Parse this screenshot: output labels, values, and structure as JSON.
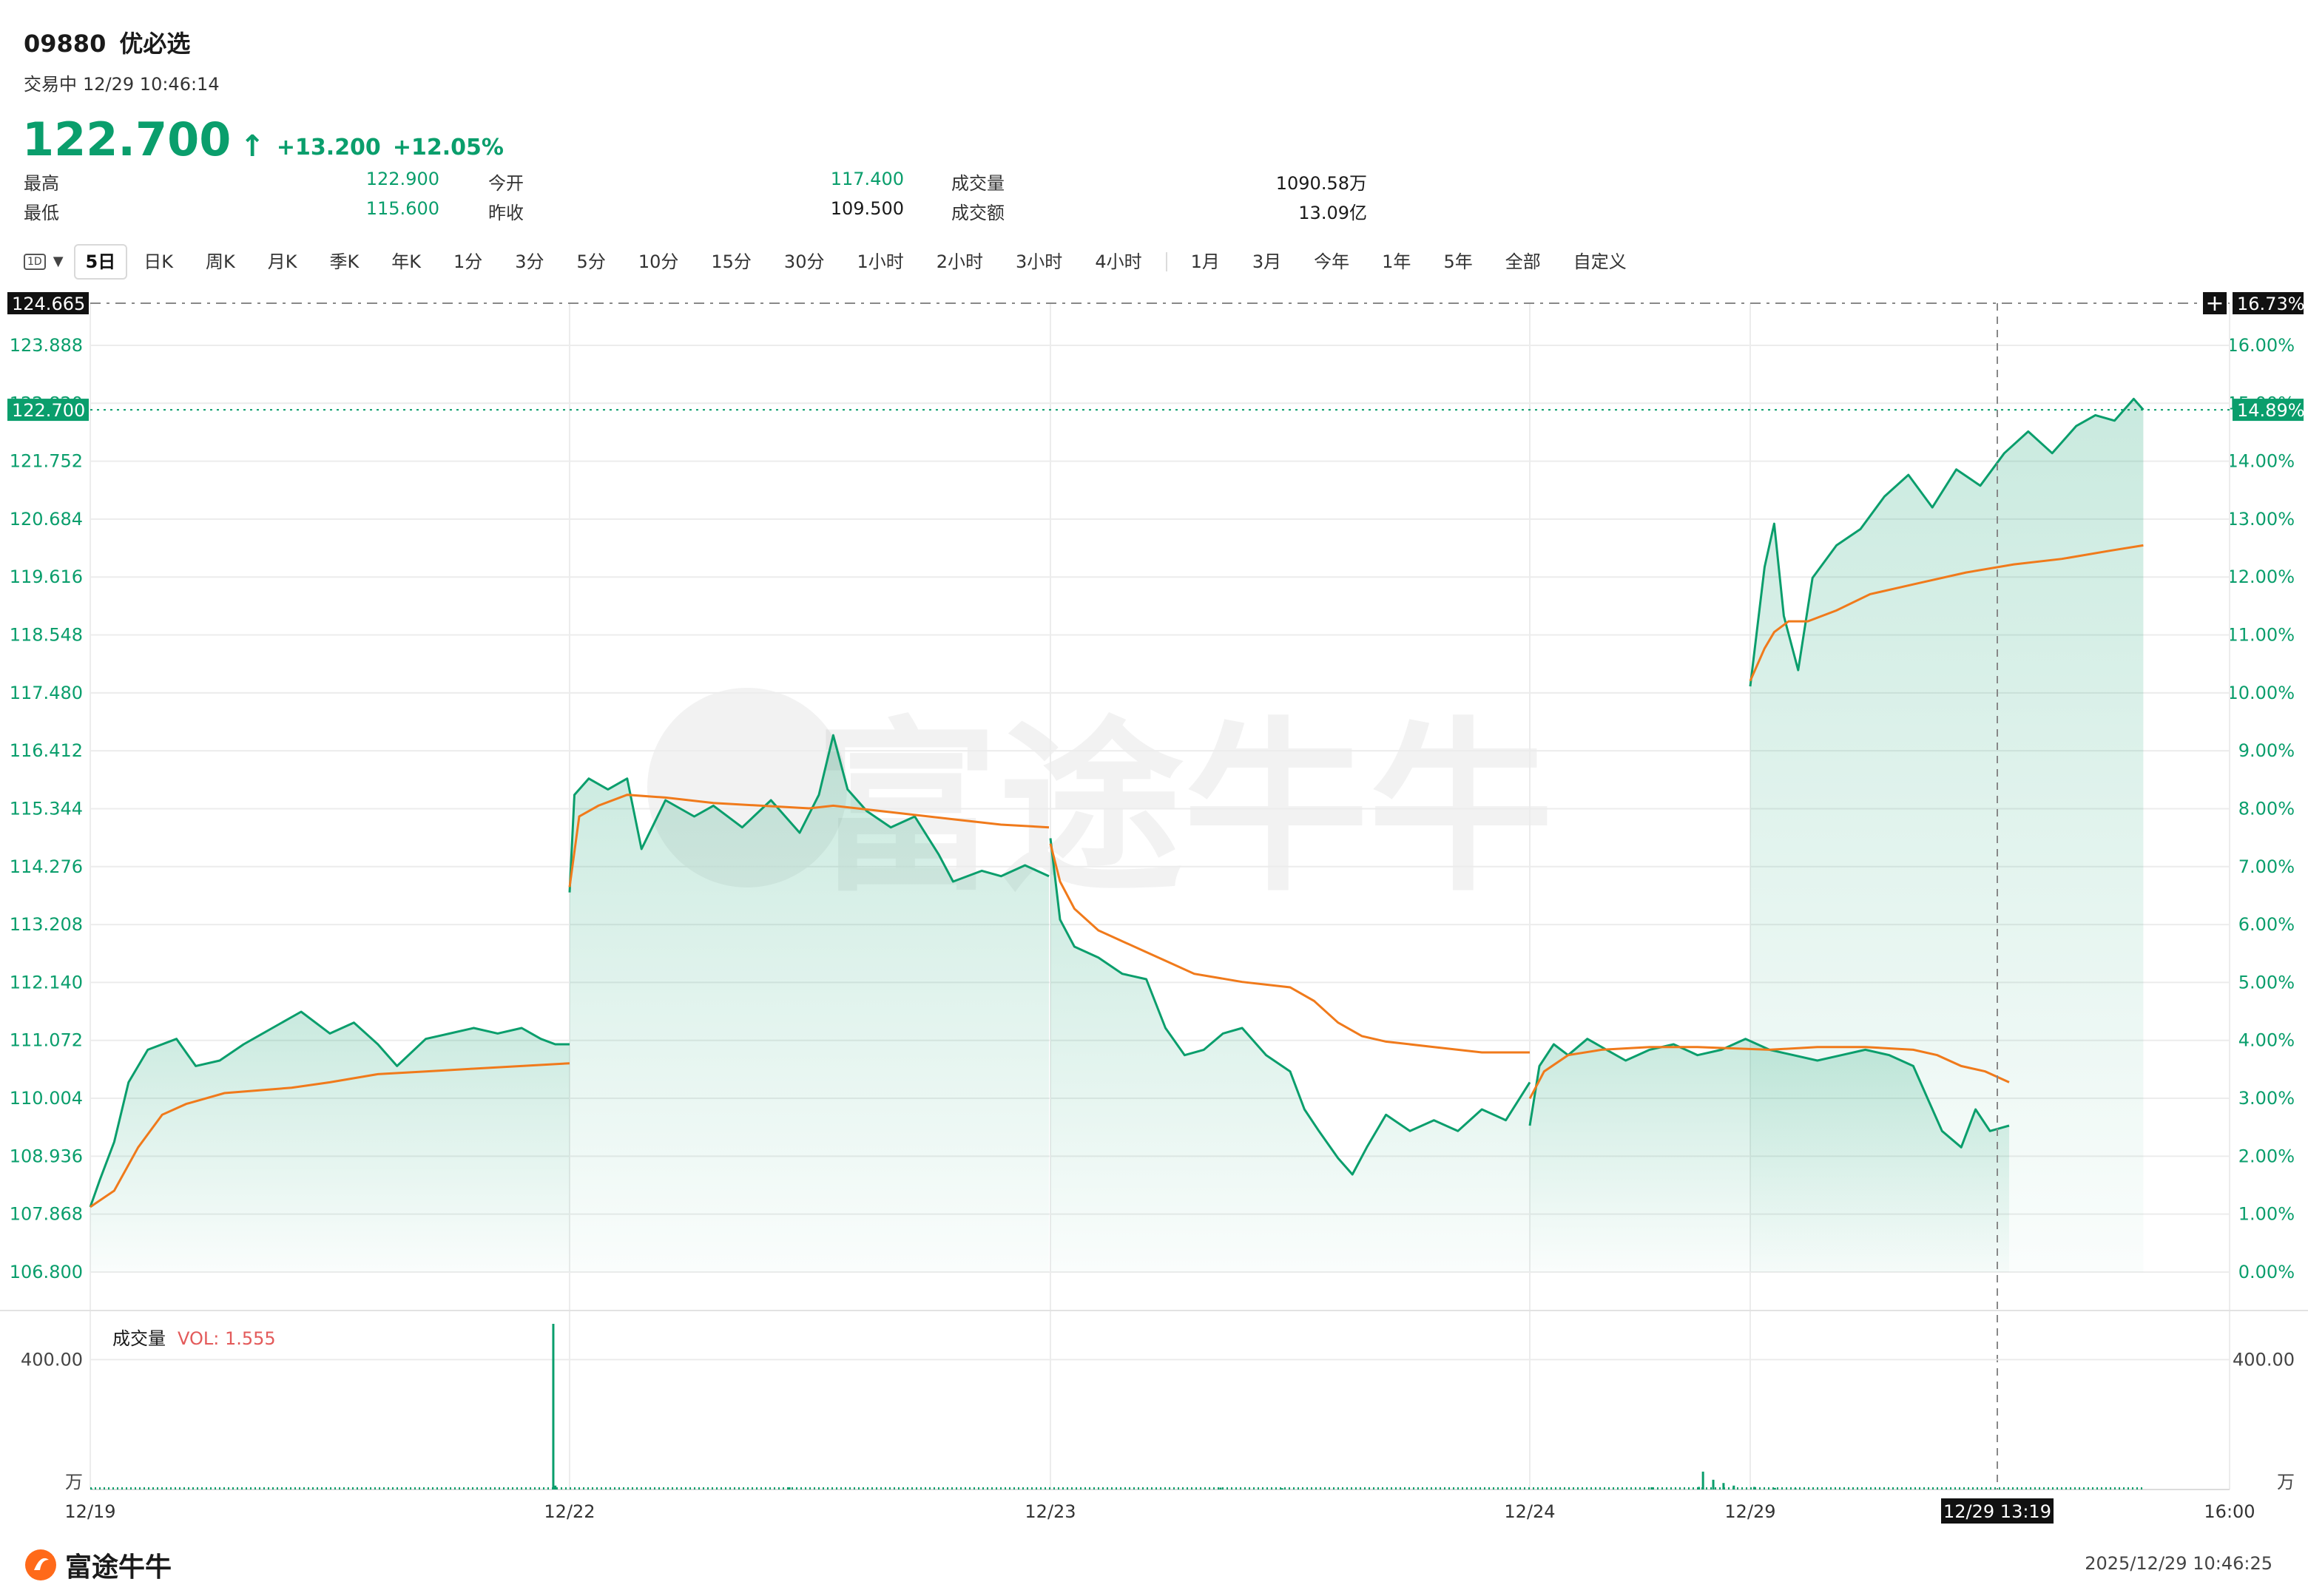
{
  "header": {
    "code": "09880",
    "name": "优必选",
    "status": "交易中",
    "time": "12/29 10:46:14",
    "price": "122.700",
    "arrow_icon": "arrow-up-icon",
    "change": "+13.200",
    "change_pct": "+12.05%"
  },
  "stats": [
    {
      "label": "最高",
      "value": "122.900",
      "color": "green"
    },
    {
      "label": "今开",
      "value": "117.400",
      "color": "green"
    },
    {
      "label": "成交量",
      "value": "1090.58万",
      "color": "dark"
    },
    {
      "label": "最低",
      "value": "115.600",
      "color": "green"
    },
    {
      "label": "昨收",
      "value": "109.500",
      "color": "dark"
    },
    {
      "label": "成交额",
      "value": "13.09亿",
      "color": "dark"
    }
  ],
  "tabs": {
    "first": "1D",
    "items": [
      "5日",
      "日K",
      "周K",
      "月K",
      "季K",
      "年K",
      "1分",
      "3分",
      "5分",
      "10分",
      "15分",
      "30分",
      "1小时",
      "2小时",
      "3小时",
      "4小时",
      "1月",
      "3月",
      "今年",
      "1年",
      "5年",
      "全部",
      "自定义"
    ],
    "active": "5日"
  },
  "chart_data": {
    "type": "line",
    "title": "",
    "x": [
      "12/19",
      "12/22",
      "12/23",
      "12/24",
      "12/29"
    ],
    "x_axis_end_label": "16:00",
    "crosshair": {
      "price": "124.665",
      "pct": "16.73%",
      "time": "12/29 13:19"
    },
    "current": {
      "price": "122.700",
      "pct": "14.89%"
    },
    "ylim": [
      106.8,
      124.665
    ],
    "y_ticks_left": [
      "123.888",
      "122.820",
      "121.752",
      "120.684",
      "119.616",
      "118.548",
      "117.480",
      "116.412",
      "115.344",
      "114.276",
      "113.208",
      "112.140",
      "111.072",
      "110.004",
      "108.936",
      "107.868",
      "106.800"
    ],
    "y_ticks_right": [
      "16.00%",
      "15.00%",
      "14.00%",
      "13.00%",
      "12.00%",
      "11.00%",
      "10.00%",
      "9.00%",
      "8.00%",
      "7.00%",
      "6.00%",
      "5.00%",
      "4.00%",
      "3.00%",
      "2.00%",
      "1.00%",
      "0.00%"
    ],
    "series": [
      {
        "values": [
          [
            [
              0,
              108.0
            ],
            [
              0.02,
              108.5
            ],
            [
              0.05,
              109.2
            ],
            [
              0.08,
              110.3
            ],
            [
              0.12,
              110.9
            ],
            [
              0.18,
              111.1
            ],
            [
              0.22,
              110.6
            ],
            [
              0.27,
              110.7
            ],
            [
              0.32,
              111.0
            ],
            [
              0.38,
              111.3
            ],
            [
              0.44,
              111.6
            ],
            [
              0.5,
              111.2
            ],
            [
              0.55,
              111.4
            ],
            [
              0.6,
              111.0
            ],
            [
              0.64,
              110.6
            ],
            [
              0.7,
              111.1
            ],
            [
              0.75,
              111.2
            ],
            [
              0.8,
              111.3
            ],
            [
              0.85,
              111.2
            ],
            [
              0.9,
              111.3
            ],
            [
              0.94,
              111.1
            ],
            [
              0.97,
              111.0
            ],
            [
              1.0,
              111.0
            ]
          ],
          [
            [
              0,
              113.8
            ],
            [
              0.01,
              115.6
            ],
            [
              0.04,
              115.9
            ],
            [
              0.08,
              115.7
            ],
            [
              0.12,
              115.9
            ],
            [
              0.15,
              114.6
            ],
            [
              0.2,
              115.5
            ],
            [
              0.26,
              115.2
            ],
            [
              0.3,
              115.4
            ],
            [
              0.36,
              115.0
            ],
            [
              0.42,
              115.5
            ],
            [
              0.48,
              114.9
            ],
            [
              0.52,
              115.6
            ],
            [
              0.55,
              116.7
            ],
            [
              0.58,
              115.7
            ],
            [
              0.62,
              115.3
            ],
            [
              0.67,
              115.0
            ],
            [
              0.72,
              115.2
            ],
            [
              0.77,
              114.5
            ],
            [
              0.8,
              114.0
            ],
            [
              0.86,
              114.2
            ],
            [
              0.9,
              114.1
            ],
            [
              0.95,
              114.3
            ],
            [
              1.0,
              114.1
            ]
          ],
          [
            [
              0,
              114.8
            ],
            [
              0.02,
              113.3
            ],
            [
              0.05,
              112.8
            ],
            [
              0.1,
              112.6
            ],
            [
              0.15,
              112.3
            ],
            [
              0.2,
              112.2
            ],
            [
              0.24,
              111.3
            ],
            [
              0.28,
              110.8
            ],
            [
              0.32,
              110.9
            ],
            [
              0.36,
              111.2
            ],
            [
              0.4,
              111.3
            ],
            [
              0.45,
              110.8
            ],
            [
              0.5,
              110.5
            ],
            [
              0.53,
              109.8
            ],
            [
              0.56,
              109.4
            ],
            [
              0.6,
              108.9
            ],
            [
              0.63,
              108.6
            ],
            [
              0.66,
              109.1
            ],
            [
              0.7,
              109.7
            ],
            [
              0.75,
              109.4
            ],
            [
              0.8,
              109.6
            ],
            [
              0.85,
              109.4
            ],
            [
              0.9,
              109.8
            ],
            [
              0.95,
              109.6
            ],
            [
              1.0,
              110.3
            ]
          ],
          [
            [
              0,
              109.5
            ],
            [
              0.02,
              110.6
            ],
            [
              0.05,
              111.0
            ],
            [
              0.08,
              110.8
            ],
            [
              0.12,
              111.1
            ],
            [
              0.16,
              110.9
            ],
            [
              0.2,
              110.7
            ],
            [
              0.25,
              110.9
            ],
            [
              0.3,
              111.0
            ],
            [
              0.35,
              110.8
            ],
            [
              0.4,
              110.9
            ],
            [
              0.45,
              111.1
            ],
            [
              0.5,
              110.9
            ],
            [
              0.55,
              110.8
            ],
            [
              0.6,
              110.7
            ],
            [
              0.65,
              110.8
            ],
            [
              0.7,
              110.9
            ],
            [
              0.75,
              110.8
            ],
            [
              0.8,
              110.6
            ],
            [
              0.83,
              110.0
            ],
            [
              0.86,
              109.4
            ],
            [
              0.9,
              109.1
            ],
            [
              0.93,
              109.8
            ],
            [
              0.96,
              109.4
            ],
            [
              1.0,
              109.5
            ]
          ],
          [
            [
              0,
              117.6
            ],
            [
              0.03,
              119.8
            ],
            [
              0.05,
              120.6
            ],
            [
              0.07,
              118.9
            ],
            [
              0.1,
              117.9
            ],
            [
              0.13,
              119.6
            ],
            [
              0.18,
              120.2
            ],
            [
              0.23,
              120.5
            ],
            [
              0.28,
              121.1
            ],
            [
              0.33,
              121.5
            ],
            [
              0.38,
              120.9
            ],
            [
              0.43,
              121.6
            ],
            [
              0.48,
              121.3
            ],
            [
              0.53,
              121.9
            ],
            [
              0.58,
              122.3
            ],
            [
              0.63,
              121.9
            ],
            [
              0.68,
              122.4
            ],
            [
              0.72,
              122.6
            ],
            [
              0.76,
              122.5
            ],
            [
              0.8,
              122.9
            ],
            [
              0.82,
              122.7
            ]
          ]
        ]
      },
      {
        "values": [
          [
            [
              0,
              108.0
            ],
            [
              0.05,
              108.3
            ],
            [
              0.1,
              109.1
            ],
            [
              0.15,
              109.7
            ],
            [
              0.2,
              109.9
            ],
            [
              0.28,
              110.1
            ],
            [
              0.35,
              110.15
            ],
            [
              0.42,
              110.2
            ],
            [
              0.5,
              110.3
            ],
            [
              0.6,
              110.45
            ],
            [
              0.7,
              110.5
            ],
            [
              0.8,
              110.55
            ],
            [
              0.9,
              110.6
            ],
            [
              1.0,
              110.65
            ]
          ],
          [
            [
              0,
              113.9
            ],
            [
              0.02,
              115.2
            ],
            [
              0.06,
              115.4
            ],
            [
              0.12,
              115.6
            ],
            [
              0.2,
              115.55
            ],
            [
              0.3,
              115.45
            ],
            [
              0.4,
              115.4
            ],
            [
              0.5,
              115.35
            ],
            [
              0.55,
              115.4
            ],
            [
              0.6,
              115.35
            ],
            [
              0.7,
              115.25
            ],
            [
              0.8,
              115.15
            ],
            [
              0.9,
              115.05
            ],
            [
              1.0,
              115.0
            ]
          ],
          [
            [
              0,
              114.7
            ],
            [
              0.02,
              114.0
            ],
            [
              0.05,
              113.5
            ],
            [
              0.1,
              113.1
            ],
            [
              0.15,
              112.9
            ],
            [
              0.2,
              112.7
            ],
            [
              0.25,
              112.5
            ],
            [
              0.3,
              112.3
            ],
            [
              0.4,
              112.15
            ],
            [
              0.5,
              112.05
            ],
            [
              0.55,
              111.8
            ],
            [
              0.6,
              111.4
            ],
            [
              0.65,
              111.15
            ],
            [
              0.7,
              111.05
            ],
            [
              0.8,
              110.95
            ],
            [
              0.9,
              110.85
            ],
            [
              1.0,
              110.85
            ]
          ],
          [
            [
              0,
              110.0
            ],
            [
              0.03,
              110.5
            ],
            [
              0.08,
              110.8
            ],
            [
              0.15,
              110.9
            ],
            [
              0.25,
              110.95
            ],
            [
              0.35,
              110.95
            ],
            [
              0.5,
              110.9
            ],
            [
              0.6,
              110.95
            ],
            [
              0.7,
              110.95
            ],
            [
              0.8,
              110.9
            ],
            [
              0.85,
              110.8
            ],
            [
              0.9,
              110.6
            ],
            [
              0.95,
              110.5
            ],
            [
              1.0,
              110.3
            ]
          ],
          [
            [
              0,
              117.7
            ],
            [
              0.03,
              118.3
            ],
            [
              0.05,
              118.6
            ],
            [
              0.08,
              118.8
            ],
            [
              0.12,
              118.8
            ],
            [
              0.18,
              119.0
            ],
            [
              0.25,
              119.3
            ],
            [
              0.35,
              119.5
            ],
            [
              0.45,
              119.7
            ],
            [
              0.55,
              119.85
            ],
            [
              0.65,
              119.95
            ],
            [
              0.75,
              120.1
            ],
            [
              0.82,
              120.2
            ]
          ]
        ]
      }
    ],
    "volume": {
      "label": "成交量",
      "vol_text": "VOL: 1.555",
      "y_tick": "400.00",
      "y_unit": "万",
      "ylim": [
        0,
        510
      ],
      "spikes": [
        [
          0.0,
          3
        ],
        [
          0.225,
          510
        ],
        [
          0.226,
          12
        ],
        [
          0.34,
          7
        ],
        [
          0.55,
          6
        ],
        [
          0.58,
          4
        ],
        [
          0.76,
          7
        ],
        [
          0.783,
          8
        ],
        [
          0.785,
          55
        ],
        [
          0.79,
          30
        ],
        [
          0.795,
          20
        ],
        [
          0.8,
          12
        ],
        [
          0.81,
          8
        ],
        [
          0.82,
          5
        ],
        [
          0.83,
          4
        ]
      ]
    },
    "colors": {
      "price": "#0a9e6c",
      "avg": "#f07a1b",
      "grid": "#ececec",
      "current_tag": "#0a9e6c",
      "crosshair_tag": "#111111",
      "vol": "#0a9e6c",
      "vol_label": "#e35a5a"
    }
  },
  "footer": {
    "logo_text": "富途牛牛",
    "logo_icon": "futu-logo-icon",
    "datetime": "2025/12/29 10:46:25"
  }
}
